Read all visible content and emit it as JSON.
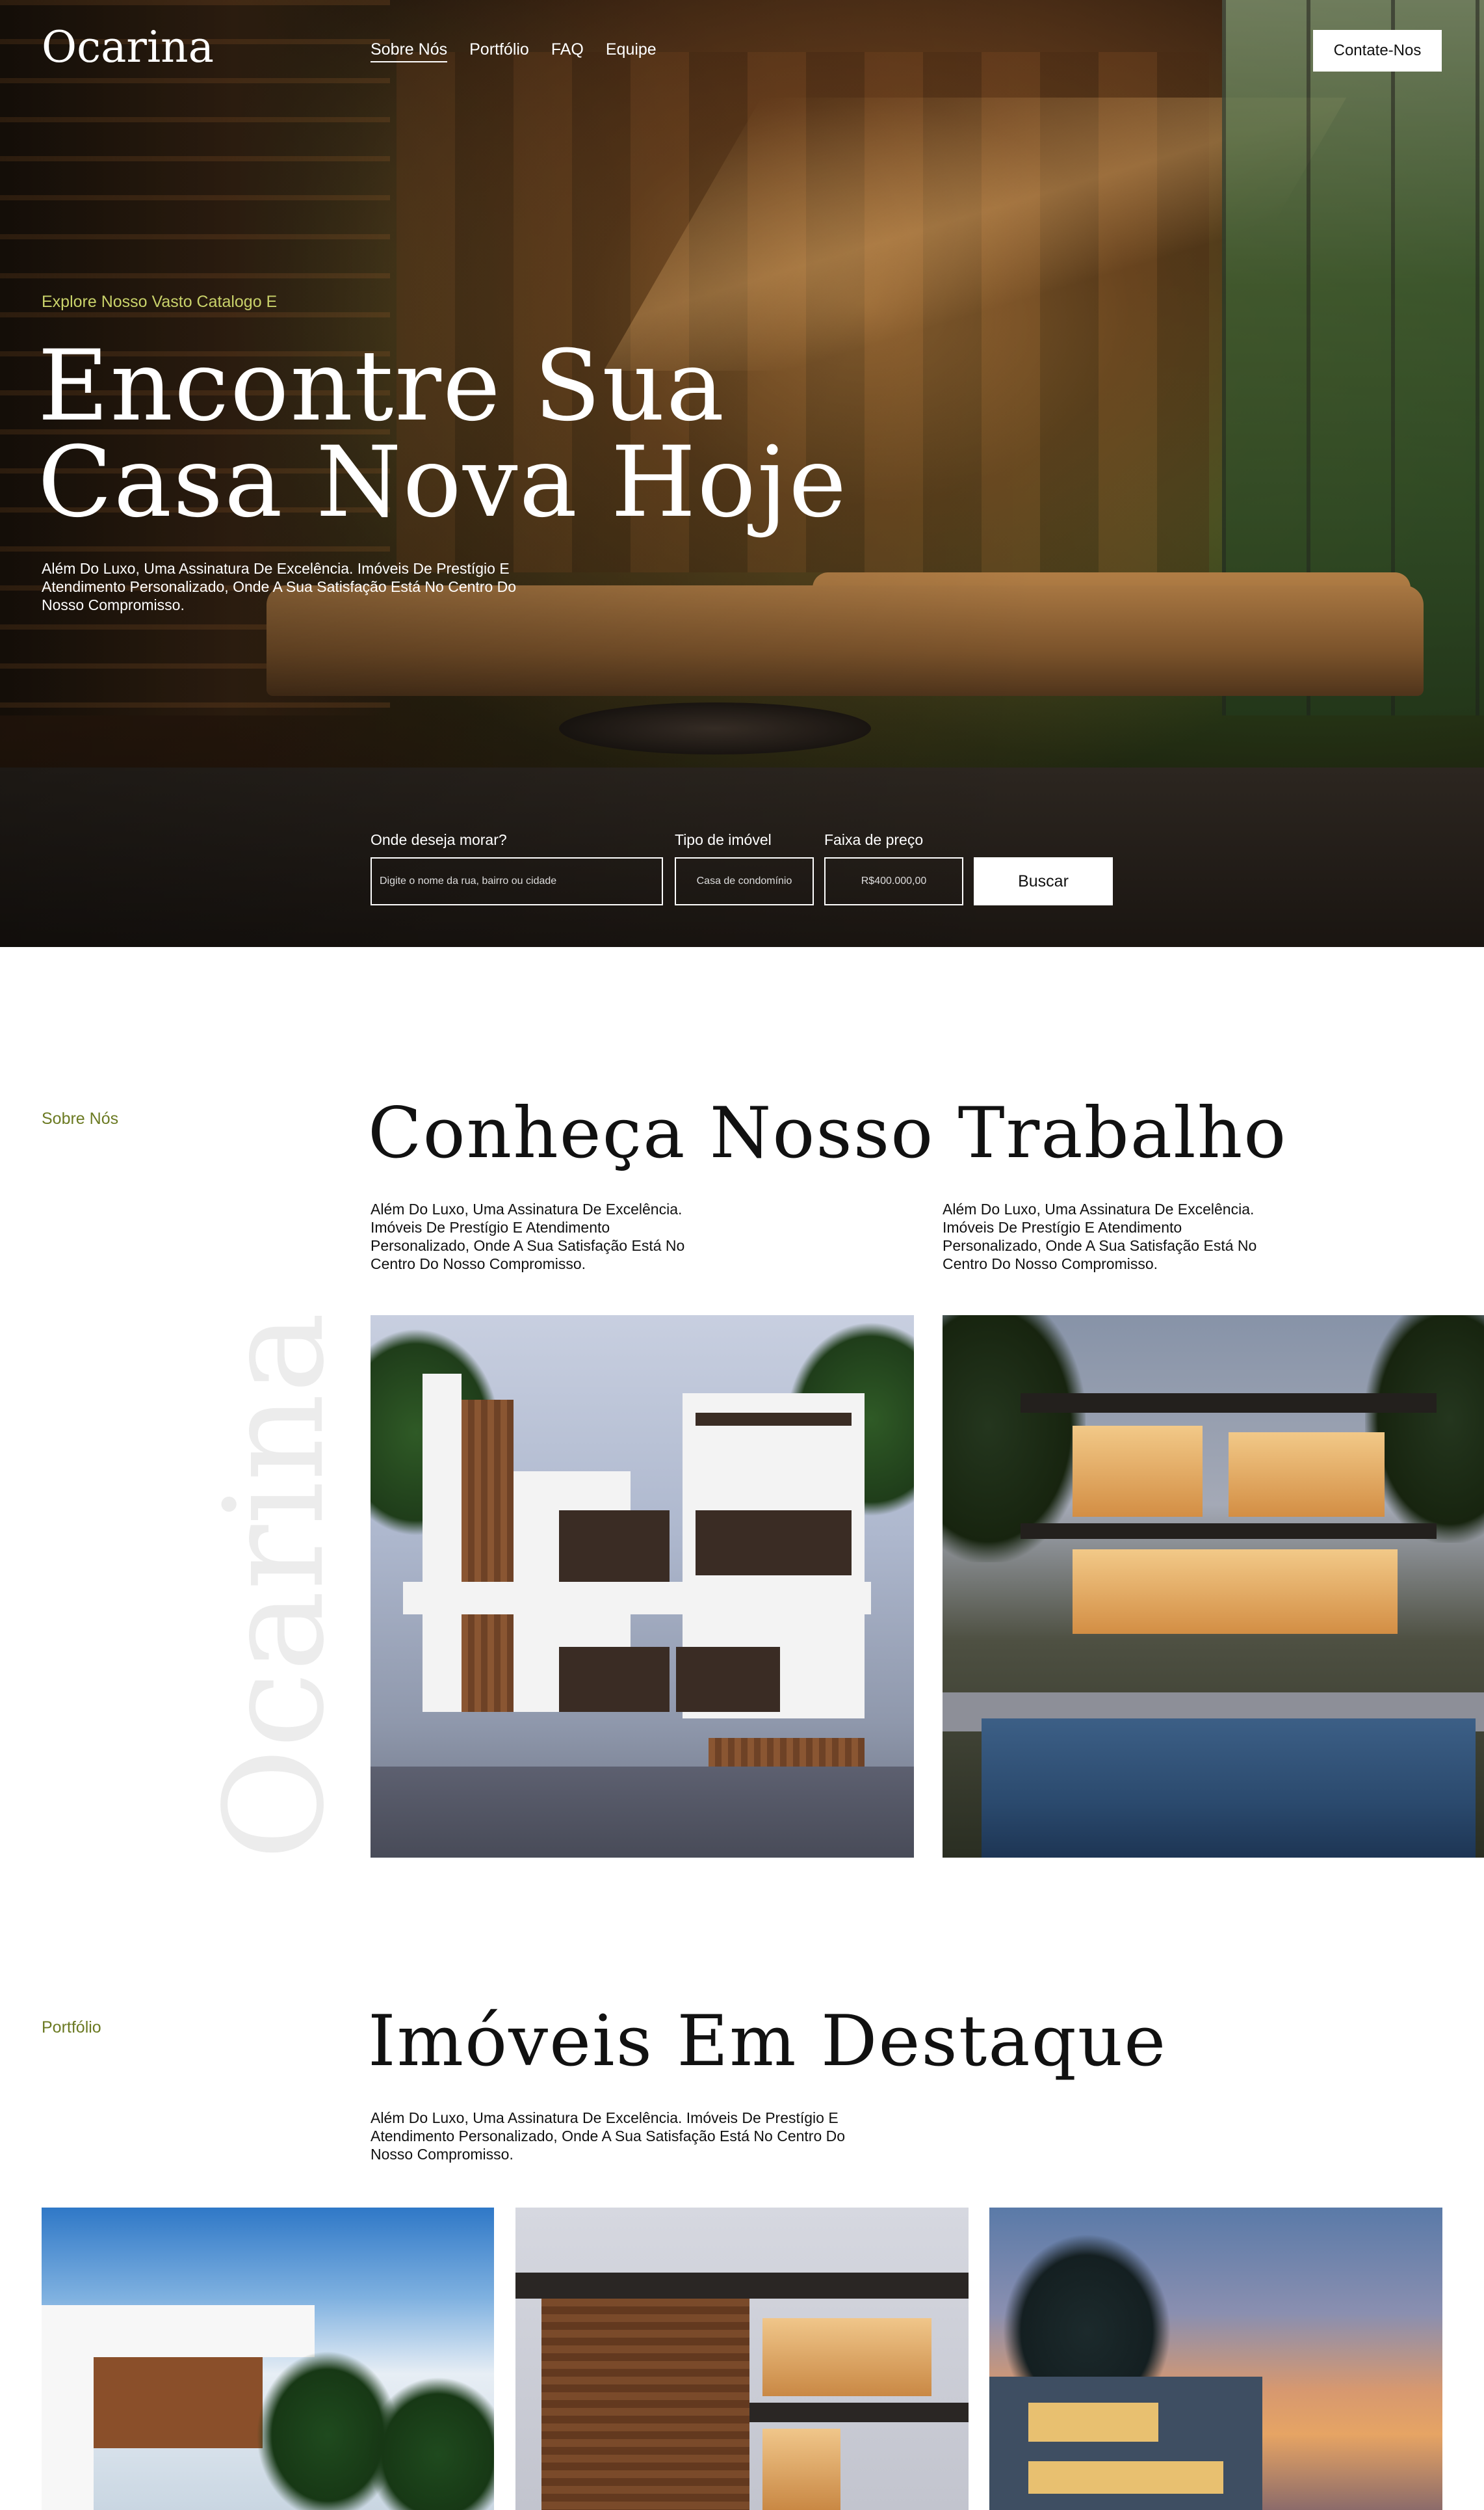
{
  "brand": {
    "logo": "Ocarina"
  },
  "nav": {
    "items": [
      {
        "label": "Sobre Nós",
        "active": true
      },
      {
        "label": "Portfólio"
      },
      {
        "label": "FAQ"
      },
      {
        "label": "Equipe"
      }
    ],
    "contact_label": "Contate-Nos"
  },
  "hero": {
    "kicker": "Explore Nosso Vasto Catalogo E",
    "title": "Encontre Sua\nCasa Nova Hoje",
    "description": "Além Do Luxo, Uma Assinatura De Excelência. Imóveis De Prestígio E Atendimento Personalizado, Onde A Sua Satisfação Está No Centro Do Nosso Compromisso."
  },
  "search": {
    "location_label": "Onde deseja morar?",
    "location_placeholder": "Digite o nome da rua, bairro ou cidade",
    "type_label": "Tipo de imóvel",
    "type_value": "Casa de condomínio",
    "price_label": "Faixa de preço",
    "price_value": "R$400.000,00",
    "button_label": "Buscar"
  },
  "about": {
    "label": "Sobre Nós",
    "title": "Conheça Nosso Trabalho",
    "text_left": "Além Do Luxo, Uma Assinatura De Excelência. Imóveis De Prestígio E Atendimento Personalizado, Onde A Sua Satisfação Está No Centro Do Nosso Compromisso.",
    "text_right": "Além Do Luxo, Uma Assinatura De Excelência. Imóveis De Prestígio E Atendimento Personalizado, Onde A Sua Satisfação Está No Centro Do Nosso Compromisso.",
    "watermark": "Ocarina"
  },
  "portfolio": {
    "label": "Portfólio",
    "title": "Imóveis Em Destaque",
    "text": "Além Do Luxo, Uma Assinatura De Excelência. Imóveis De Prestígio E Atendimento Personalizado, Onde A Sua Satisfação Está No Centro Do Nosso Compromisso."
  }
}
